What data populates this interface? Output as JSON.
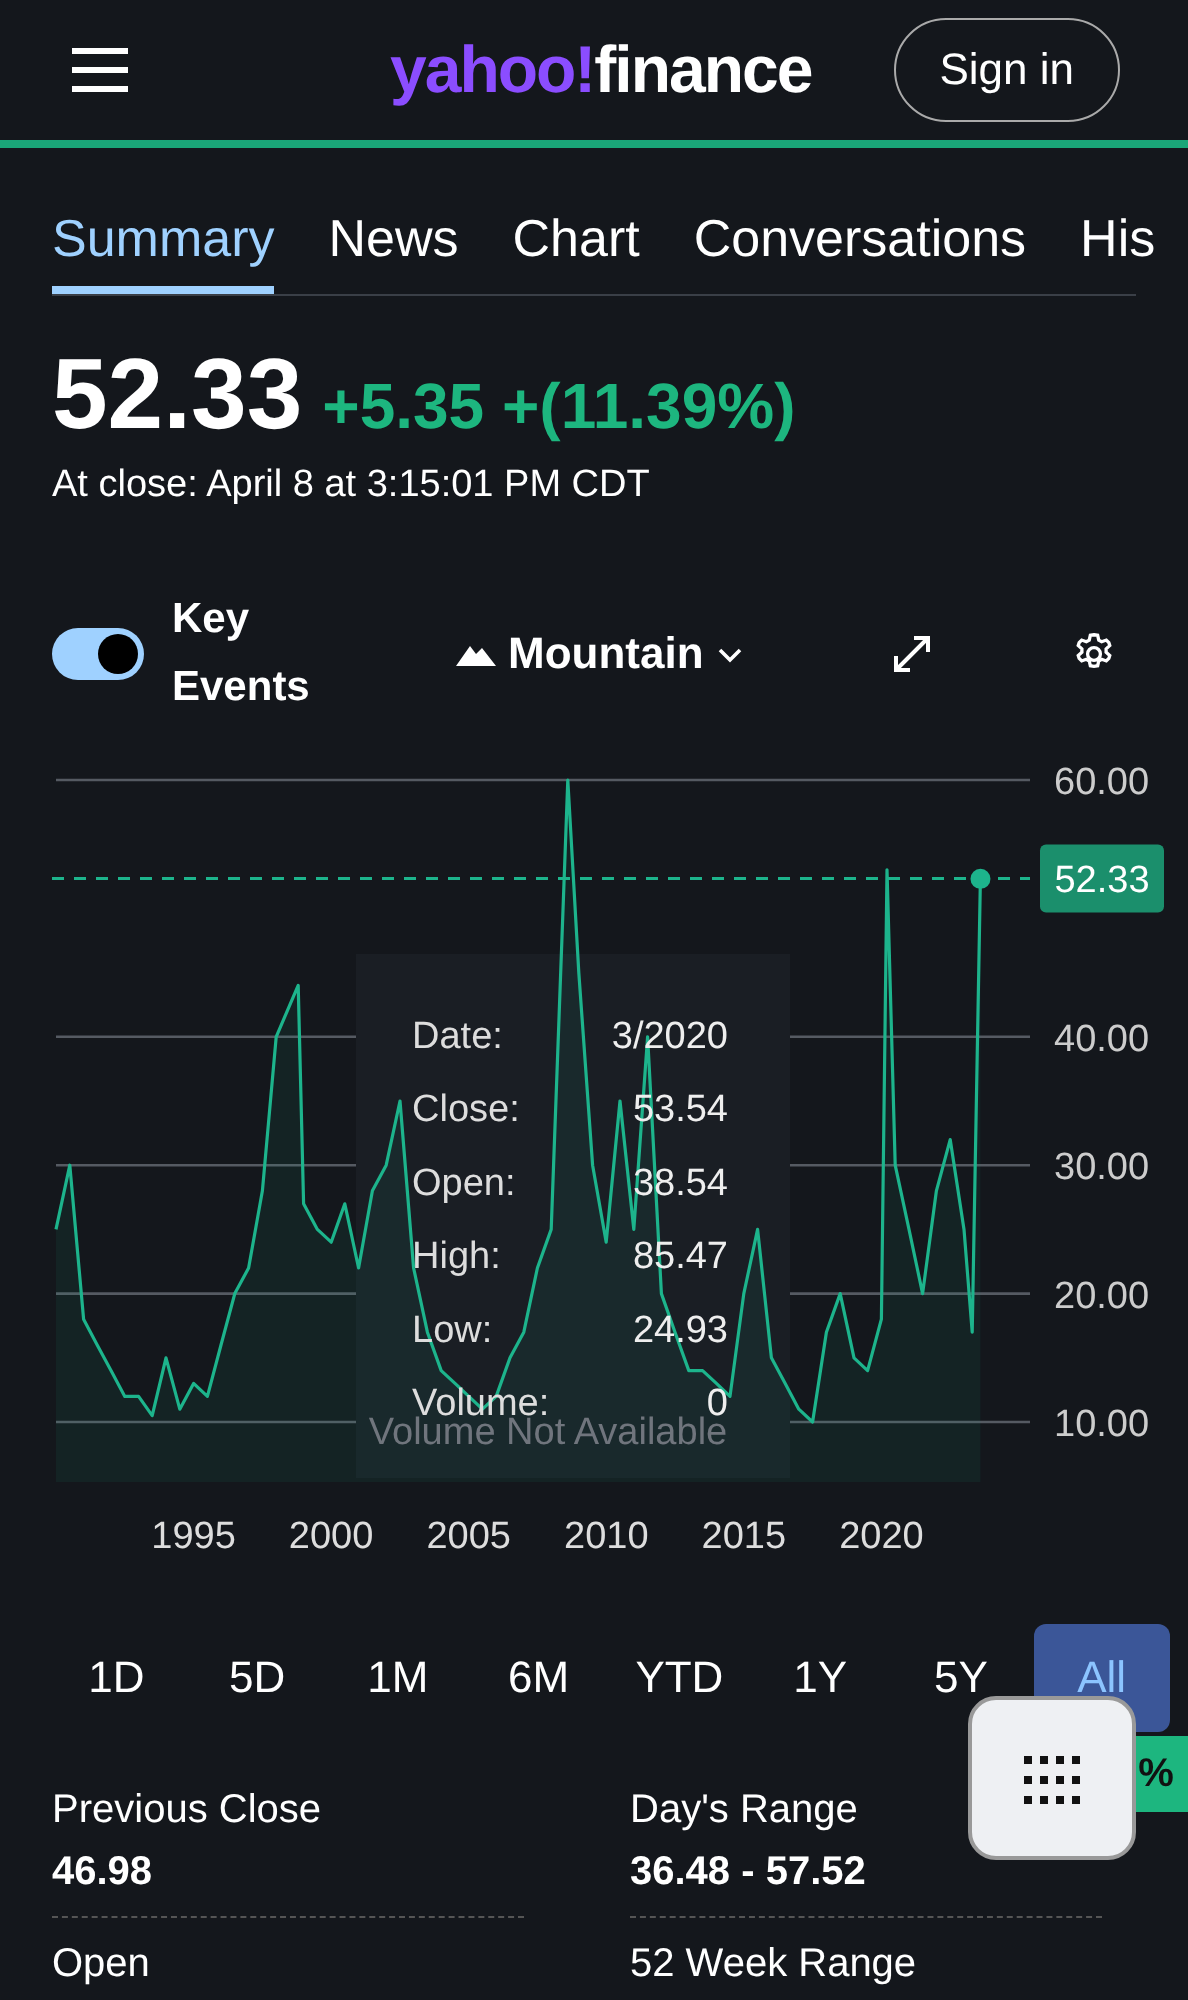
{
  "header": {
    "logo": {
      "brand": "yahoo!",
      "product": "finance"
    },
    "sign_in": "Sign in"
  },
  "tabs": [
    {
      "label": "Summary",
      "selected": true
    },
    {
      "label": "News",
      "selected": false
    },
    {
      "label": "Chart",
      "selected": false
    },
    {
      "label": "Conversations",
      "selected": false
    },
    {
      "label": "His",
      "selected": false
    }
  ],
  "quote": {
    "price": "52.33",
    "change": "+5.35 +(11.39%)",
    "close_time": "At close: April 8 at 3:15:01 PM CDT"
  },
  "chart_controls": {
    "key_events": {
      "label": "Key Events",
      "on": true
    },
    "chart_type": "Mountain"
  },
  "chart": {
    "chart_data": {
      "type": "area",
      "x": [
        1990,
        1990.5,
        1991,
        1991.5,
        1992,
        1992.5,
        1993,
        1993.5,
        1994,
        1994.5,
        1995,
        1995.5,
        1996,
        1996.5,
        1997,
        1997.5,
        1998,
        1998.8,
        1999,
        1999.5,
        2000,
        2000.5,
        2001,
        2001.5,
        2002,
        2002.5,
        2003,
        2003.5,
        2004,
        2004.5,
        2005,
        2005.5,
        2006,
        2006.5,
        2007,
        2007.5,
        2008,
        2008.6,
        2009,
        2009.5,
        2010,
        2010.5,
        2011,
        2011.5,
        2012,
        2012.5,
        2013,
        2013.5,
        2014,
        2014.5,
        2015,
        2015.5,
        2016,
        2016.5,
        2017,
        2017.5,
        2018,
        2018.5,
        2019,
        2019.5,
        2020,
        2020.2,
        2020.5,
        2021,
        2021.5,
        2022,
        2022.5,
        2023,
        2023.3,
        2023.6
      ],
      "series": [
        {
          "color": "#1db48c",
          "values": [
            25,
            30,
            18,
            16,
            14,
            12,
            12,
            10.5,
            15,
            11,
            13,
            12,
            16,
            20,
            22,
            28,
            40,
            44,
            27,
            25,
            24,
            27,
            22,
            28,
            30,
            35,
            22,
            17,
            14,
            13,
            12,
            11,
            12,
            15,
            17,
            22,
            25,
            60,
            45,
            30,
            24,
            35,
            25,
            40,
            20,
            17,
            14,
            14,
            13,
            12,
            20,
            25,
            15,
            13,
            11,
            10,
            17,
            20,
            15,
            14,
            18,
            53,
            30,
            25,
            20,
            28,
            32,
            25,
            17,
            52.3
          ]
        }
      ],
      "xlim": [
        1990,
        2025.4
      ],
      "xticks": [
        1995,
        2000,
        2005,
        2010,
        2015,
        2020
      ],
      "yticks": [
        {
          "value": 10,
          "label": "10.00"
        },
        {
          "value": 20,
          "label": "20.00"
        },
        {
          "value": 30,
          "label": "30.00"
        },
        {
          "value": 40,
          "label": "40.00"
        },
        {
          "value": 60,
          "label": "60.00"
        }
      ],
      "ylim": [
        10,
        60
      ],
      "grid": true,
      "ref_lines": [
        {
          "axis": "y",
          "value": 52.33,
          "label": "52.33"
        }
      ]
    },
    "tooltip": [
      {
        "label": "Date:",
        "value": "3/2020"
      },
      {
        "label": "Close:",
        "value": "53.54"
      },
      {
        "label": "Open:",
        "value": "38.54"
      },
      {
        "label": "High:",
        "value": "85.47"
      },
      {
        "label": "Low:",
        "value": "24.93"
      },
      {
        "label": "Volume:",
        "value": "0"
      }
    ],
    "volume_note": "Volume Not Available"
  },
  "ranges": [
    {
      "label": "1D",
      "selected": false
    },
    {
      "label": "5D",
      "selected": false
    },
    {
      "label": "1M",
      "selected": false
    },
    {
      "label": "6M",
      "selected": false
    },
    {
      "label": "YTD",
      "selected": false
    },
    {
      "label": "1Y",
      "selected": false
    },
    {
      "label": "5Y",
      "selected": false
    },
    {
      "label": "All",
      "selected": true
    }
  ],
  "percent_badge": "%",
  "stats": [
    {
      "label": "Previous Close",
      "value": "46.98"
    },
    {
      "label": "Day's Range",
      "value": "36.48 - 57.52"
    },
    {
      "label": "Open"
    },
    {
      "label": "52 Week Range"
    }
  ]
}
